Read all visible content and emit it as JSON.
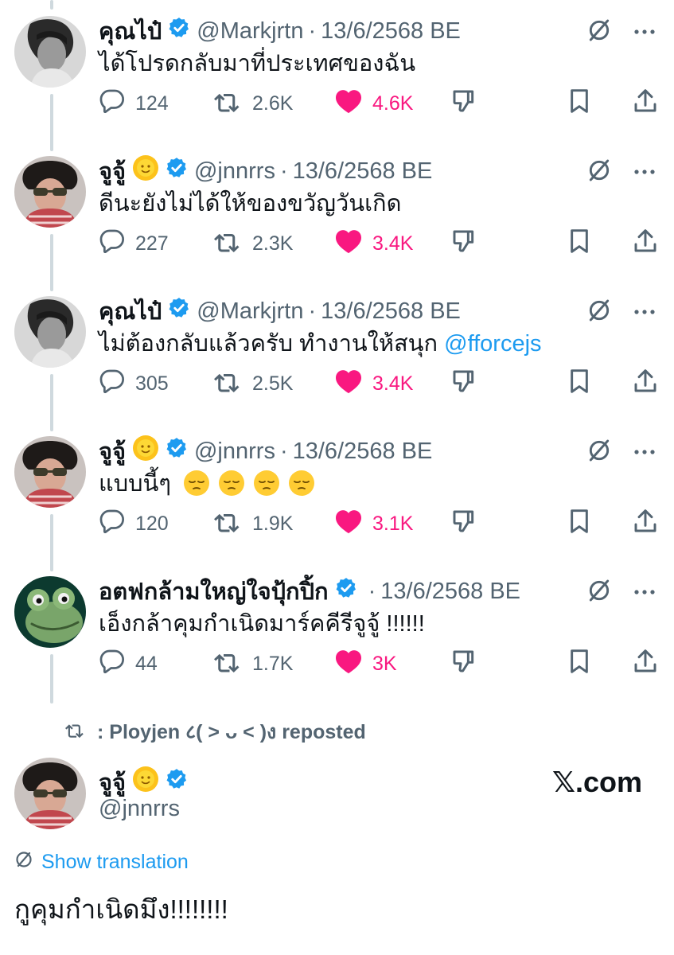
{
  "colors": {
    "accent": "#1d9bf0",
    "like": "#f91880",
    "muted": "#536471",
    "text": "#0f1419",
    "thread": "#cfd9de"
  },
  "tweets": [
    {
      "name": "คุณไป๋",
      "handle": "@Markjrtn",
      "date": "13/6/2568 BE",
      "text": "ได้โปรดกลับมาที่ประเทศของฉัน",
      "mention": "",
      "replies": "124",
      "reposts": "2.6K",
      "likes": "4.6K",
      "avatar": "avatar-gray",
      "sun": false
    },
    {
      "name": "จูจู้",
      "handle": "@jnnrrs",
      "date": "13/6/2568 BE",
      "text": "ดีนะยังไม่ได้ให้ของขวัญวันเกิด",
      "mention": "",
      "replies": "227",
      "reposts": "2.3K",
      "likes": "3.4K",
      "avatar": "avatar-sunglasses",
      "sun": true
    },
    {
      "name": "คุณไป๋",
      "handle": "@Markjrtn",
      "date": "13/6/2568 BE",
      "text": "ไม่ต้องกลับแล้วครับ ทำงานให้สนุก ",
      "mention": "@fforcejs",
      "replies": "305",
      "reposts": "2.5K",
      "likes": "3.4K",
      "avatar": "avatar-gray",
      "sun": false
    },
    {
      "name": "จูจู้",
      "handle": "@jnnrrs",
      "date": "13/6/2568 BE",
      "text": "แบบนี้ๆ",
      "mention": "",
      "replies": "120",
      "reposts": "1.9K",
      "likes": "3.1K",
      "avatar": "avatar-sunglasses",
      "sun": true,
      "emoji_count": 4
    },
    {
      "name": "อตฟกล้ามใหญ่ใจปุ้กปิ้ก",
      "handle": "",
      "date": "13/6/2568 BE",
      "text": "เอ็งกล้าคุมกำเนิดมาร์คคีรีจูจู้ !!!!!!",
      "mention": "",
      "replies": "44",
      "reposts": "1.7K",
      "likes": "3K",
      "avatar": "avatar-frog",
      "sun": false
    }
  ],
  "repost_banner": ": Ployjen ८( ˃ ᴗ ˂ )ง reposted",
  "main_tweet": {
    "name": "จูจู้",
    "handle": "@jnnrrs",
    "site": "𝕏.com",
    "show_translation": "Show translation",
    "text": "กูคุมกำเนิดมึง!!!!!!!!"
  },
  "icons": [
    "reply-icon",
    "repost-icon",
    "like-icon",
    "dislike-icon",
    "bookmark-icon",
    "share-icon",
    "grok-icon",
    "more-icon",
    "verified-icon",
    "sun-emoji-icon",
    "pensive-emoji-icon",
    "translate-icon"
  ]
}
